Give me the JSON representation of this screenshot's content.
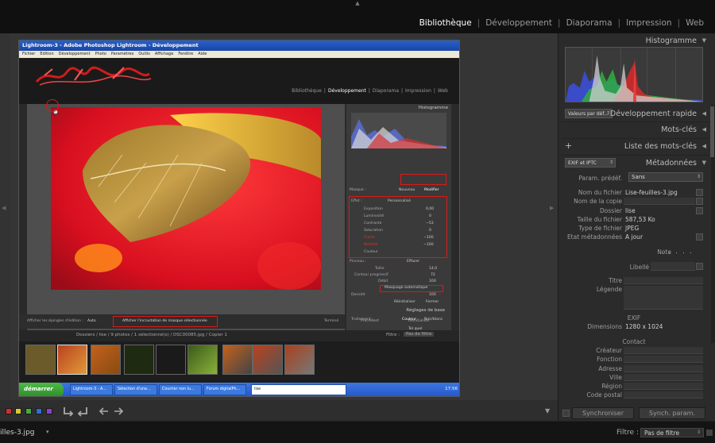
{
  "modules": [
    "Bibliothèque",
    "Développement",
    "Diaporama",
    "Impression",
    "Web"
  ],
  "right_panel": {
    "histogram_title": "Histogramme",
    "preset_select": "Valeurs par déf...",
    "quick_develop": "Développement rapide",
    "keywords": "Mots-clés",
    "keyword_list": "Liste des mots-clés",
    "exif_select": "EXIF et IPTC",
    "metadata": "Métadonnées",
    "preset_label": "Param. prédéf.",
    "preset_value": "Sans",
    "rows": [
      {
        "label": "Nom du fichier",
        "value": "Lise-feuilles-3.jpg"
      },
      {
        "label": "Nom de la copie",
        "value": ""
      },
      {
        "label": "Dossier",
        "value": "lise"
      },
      {
        "label": "Taille du fichier",
        "value": "587,53 Ko"
      },
      {
        "label": "Type de fichier",
        "value": "JPEG"
      },
      {
        "label": "Etat métadonnées",
        "value": "A jour"
      }
    ],
    "note_label": "Note",
    "note_value": ". . . . .",
    "libelle_label": "Libellé",
    "titre_label": "Titre",
    "legende_label": "Légende",
    "exif_head": "EXIF",
    "dimensions_label": "Dimensions",
    "dimensions_value": "1280 x 1024",
    "contact_head": "Contact",
    "contact_rows": [
      "Créateur",
      "Fonction",
      "Adresse",
      "Ville",
      "Région",
      "Code postal"
    ],
    "sync_button": "Synchroniser",
    "sync_params_button": "Synch. param."
  },
  "inner": {
    "title": "Lightroom-3 - Adobe Photoshop Lightroom - Développement",
    "menu": [
      "Fichier",
      "Edition",
      "Développement",
      "Photo",
      "Paramètres",
      "Outils",
      "Affichage",
      "Fenêtre",
      "Aide"
    ],
    "modules": [
      "Bibliothèque",
      "Développement",
      "Diaporama",
      "Impression",
      "Web"
    ],
    "histogram": "Histogramme",
    "masque_label": "Masque :",
    "masque_new": "Nouveau",
    "masque_edit": "Modifier",
    "effet_label": "Effet :",
    "effet_value": "Personnalisé",
    "sliders": [
      {
        "label": "Exposition",
        "value": "0,00"
      },
      {
        "label": "Luminosité",
        "value": "0"
      },
      {
        "label": "Contraste",
        "value": "−53"
      },
      {
        "label": "Saturation",
        "value": "0"
      },
      {
        "label": "Clarté",
        "value": "−100"
      },
      {
        "label": "Netteté",
        "value": "−100"
      },
      {
        "label": "Couleur",
        "value": ""
      }
    ],
    "pinceau_label": "Pinceau :",
    "pinceau_effacer": "Effacer",
    "taille_label": "Taille",
    "taille_value": "14,0",
    "contour_label": "Contour progressif",
    "contour_value": "72",
    "debit_label": "Débit",
    "debit_value": "100",
    "auto_mask": "Masquage automatique",
    "densite_label": "Densité",
    "densite_value": "100",
    "reset_label": "Réinitialiser",
    "close_label": "Fermer",
    "basic_settings": "Réglages de base",
    "traitement": "Traitement :",
    "couleur": "Couleur",
    "noir_blanc": "Noir/blanc",
    "tel_quel": "Tel quel",
    "temperature": "Température",
    "teinte": "Teinte",
    "toolbar_show_pins": "Afficher les épingles d'édition :",
    "toolbar_auto": "Auto",
    "toolbar_overlay": "Afficher l'incrustation de masque sélectionnée",
    "toolbar_done": "Terminé",
    "prev_btn": "Précédent",
    "reset_btn": "Réinitialiser",
    "film_path": "Dossiers / lise / 9 photos / 1 sélectionné(s) / DSC00085.jpg / Copier 1",
    "film_filter_label": "Filtre :",
    "film_filter": "Pas de filtre",
    "start": "démarrer",
    "tasks": [
      "Lightroom-3 - A...",
      "Sélection d'une...",
      "Courrier non lu...",
      "Forum digitalPh...",
      "lise"
    ],
    "clock": "17:56"
  },
  "filmstrip": {
    "file_name": "illes-3.jpg",
    "filter_label": "Filtre :",
    "filter_value": "Pas de filtre"
  },
  "flag_colors": [
    "#d32d2d",
    "#d8c92a",
    "#3fae3f",
    "#2f6fd6",
    "#8a3fd1"
  ],
  "icons": [
    "triangle-up-icon",
    "arrow-turn-icon",
    "arrow-left-icon",
    "arrow-right-icon",
    "triangle-down-icon"
  ]
}
